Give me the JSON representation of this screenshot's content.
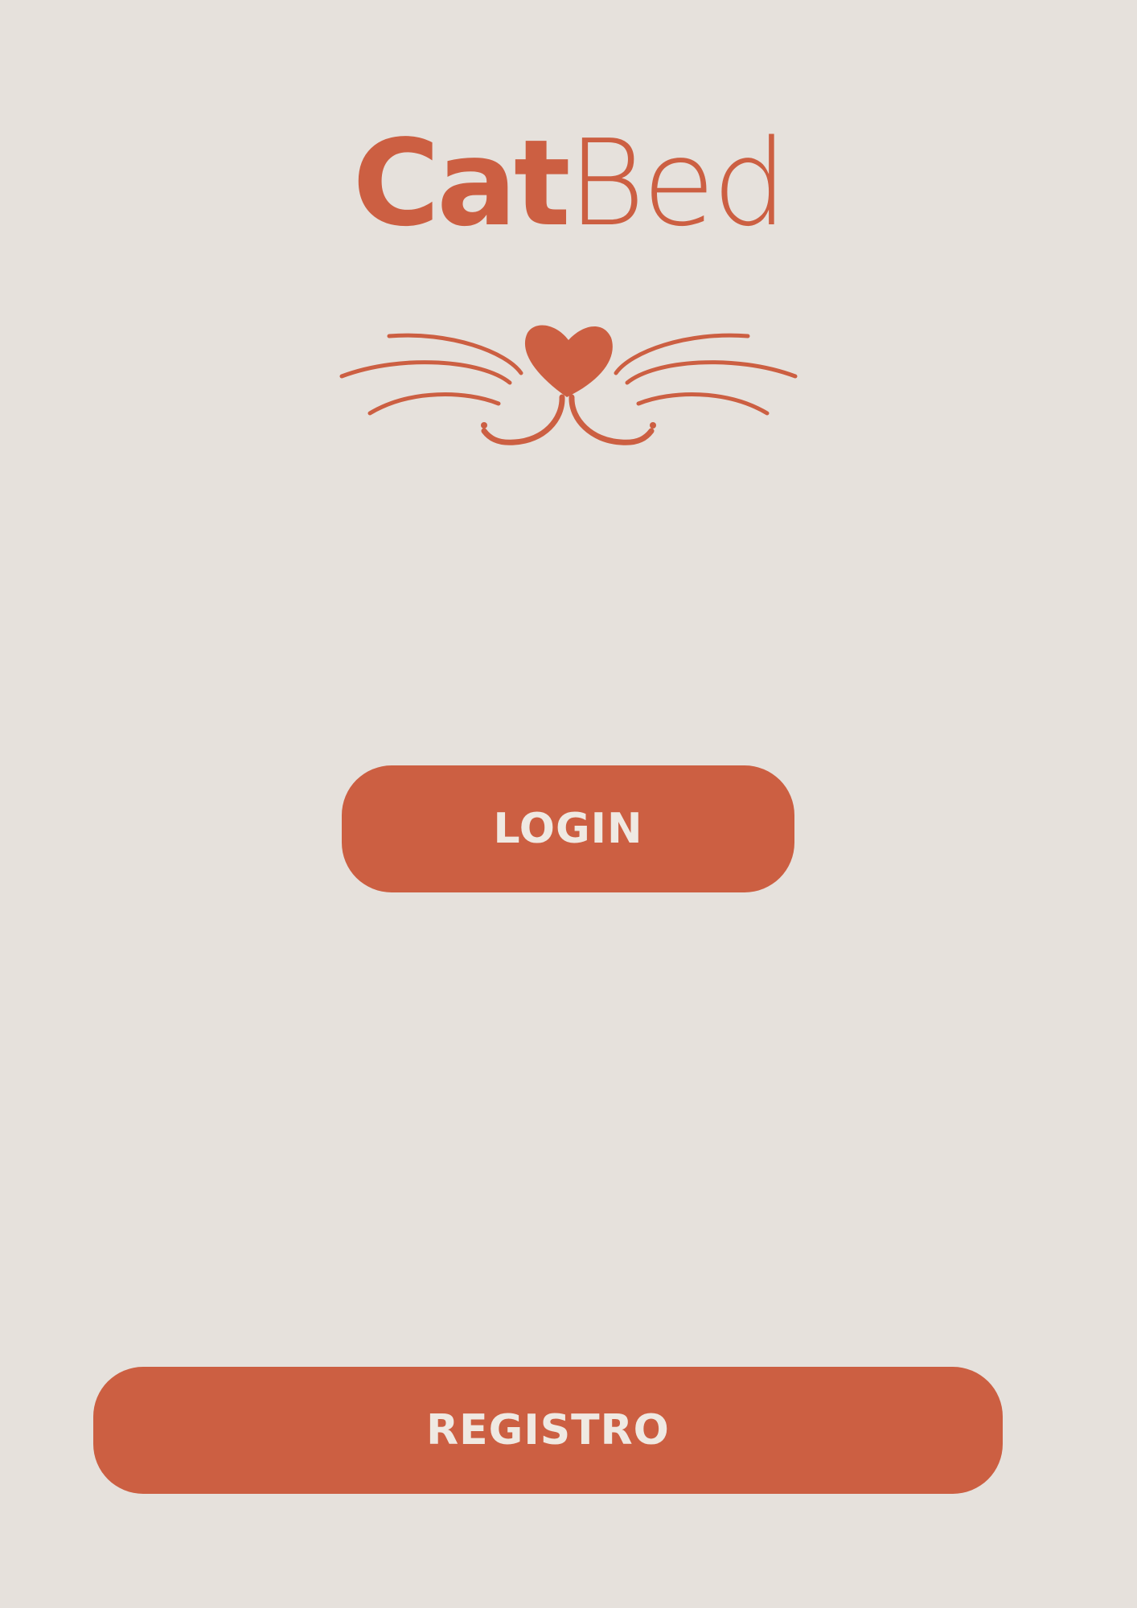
{
  "app": {
    "logo_bold": "Cat",
    "logo_light": "Bed"
  },
  "icons": {
    "cat_face": "cat-nose-whiskers-icon"
  },
  "actions": {
    "login_label": "LOGIN",
    "register_label": "REGISTRO"
  },
  "colors": {
    "background": "#e6e1dc",
    "accent": "#cc5f42",
    "button_text": "#efe9e2"
  }
}
